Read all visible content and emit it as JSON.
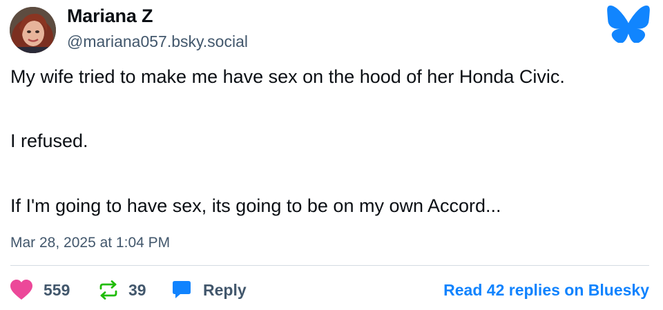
{
  "author": {
    "display_name": "Mariana Z",
    "handle": "@mariana057.bsky.social",
    "avatar_icon": "profile-photo"
  },
  "brand": {
    "logo_icon": "bluesky-butterfly-icon",
    "color": "#1185fe"
  },
  "post": {
    "lines": [
      "My wife tried to make me have sex on the hood of her Honda Civic.",
      "I refused.",
      "If I'm going to have sex, its going to be on my own Accord..."
    ],
    "timestamp": "Mar 28, 2025 at 1:04 PM"
  },
  "actions": {
    "likes": "559",
    "reposts": "39",
    "reply_label": "Reply",
    "read_replies_label": "Read 42 replies on Bluesky"
  },
  "colors": {
    "like": "#ec4899",
    "repost": "#20bc07",
    "reply": "#1083fe",
    "link": "#1083fe",
    "secondary_text": "#42576c"
  }
}
